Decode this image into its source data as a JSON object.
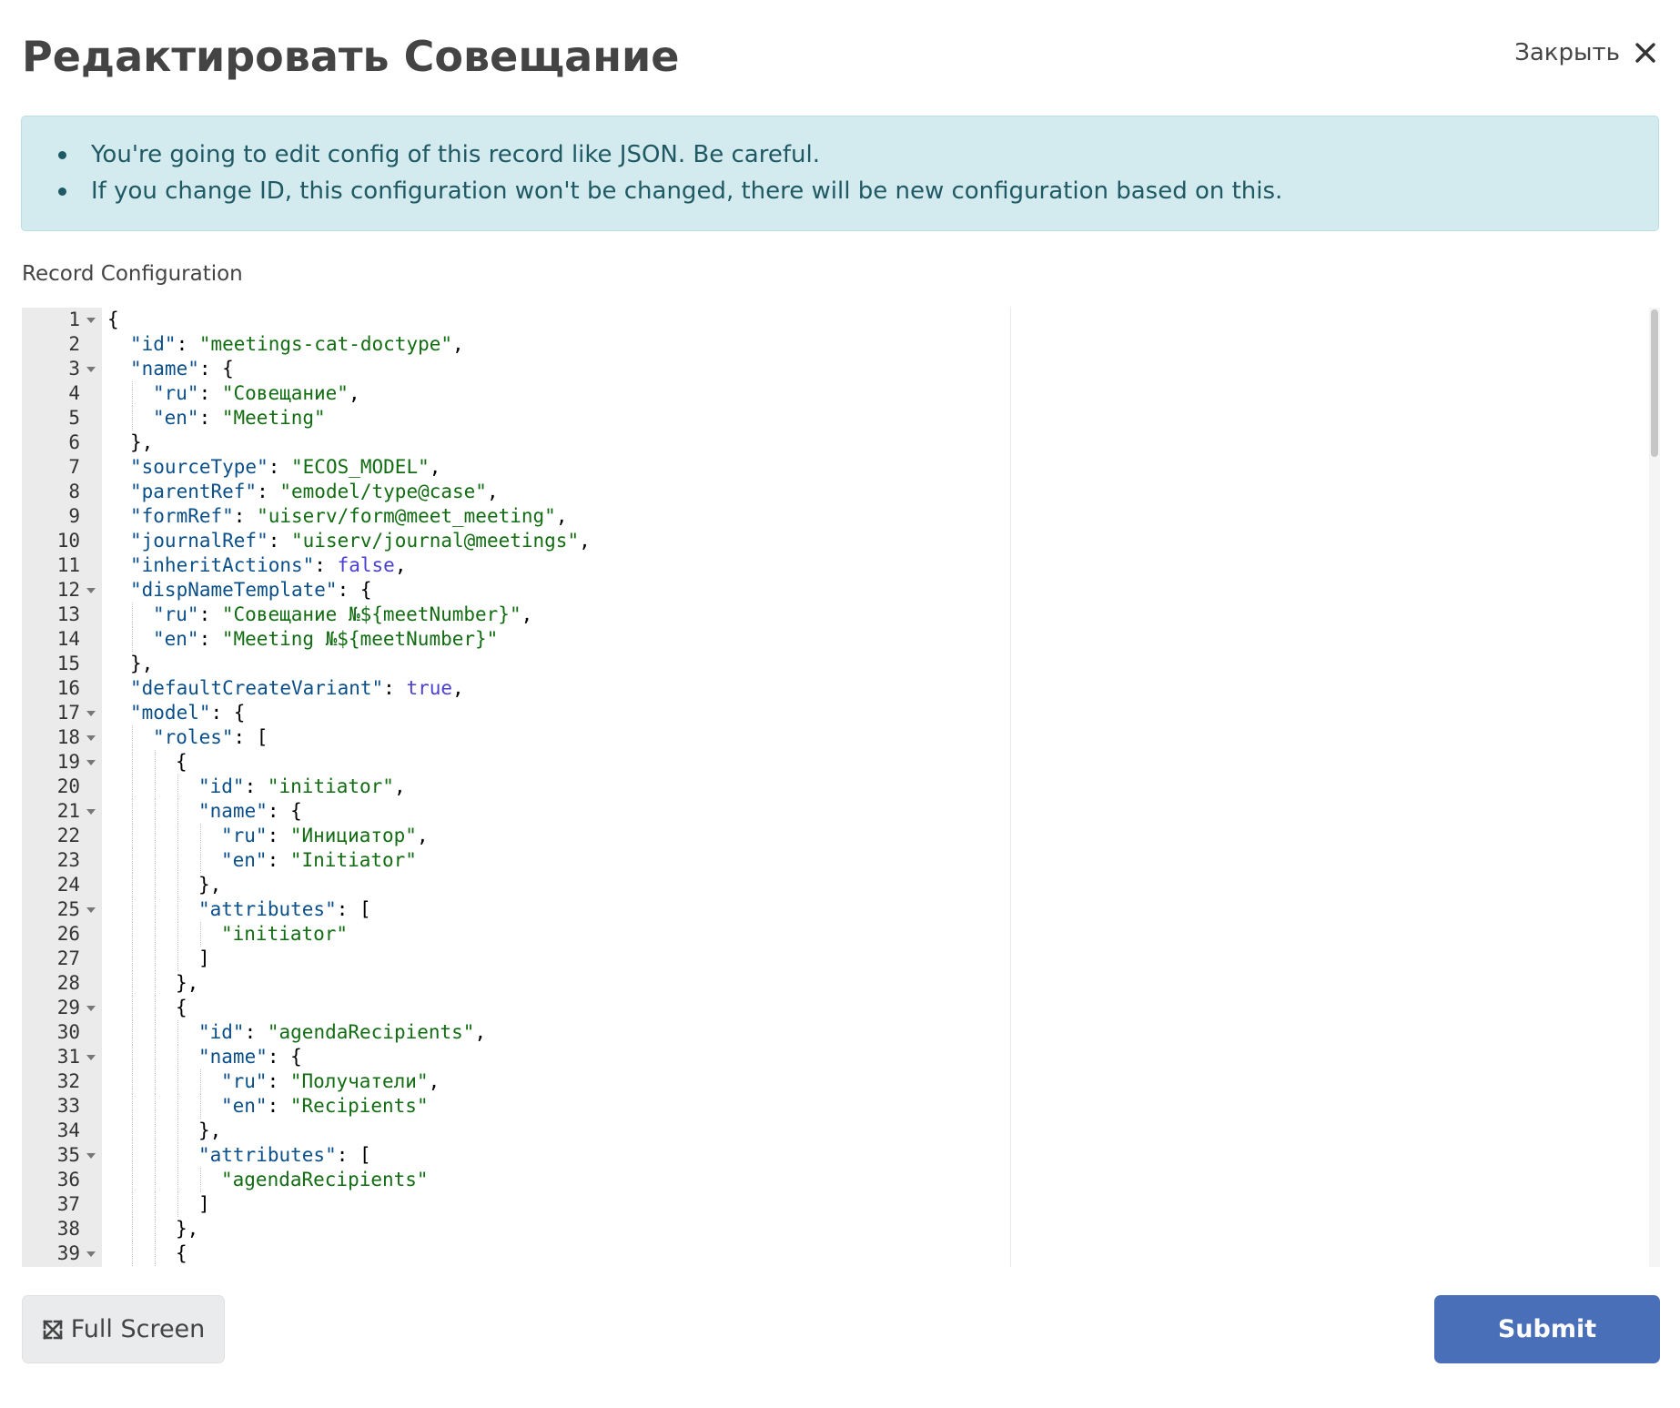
{
  "header": {
    "title": "Редактировать Совещание",
    "close_label": "Закрыть"
  },
  "alert": {
    "items": [
      "You're going to edit config of this record like JSON. Be careful.",
      "If you change ID, this configuration won't be changed, there will be new configuration based on this."
    ]
  },
  "editor": {
    "label": "Record Configuration",
    "lines": [
      {
        "n": "1",
        "fold": true,
        "indent": 0,
        "tokens": [
          {
            "t": "p",
            "v": "{"
          }
        ]
      },
      {
        "n": "2",
        "fold": false,
        "indent": 1,
        "tokens": [
          {
            "t": "k",
            "v": "\"id\""
          },
          {
            "t": "p",
            "v": ": "
          },
          {
            "t": "s",
            "v": "\"meetings-cat-doctype\""
          },
          {
            "t": "p",
            "v": ","
          }
        ]
      },
      {
        "n": "3",
        "fold": true,
        "indent": 1,
        "tokens": [
          {
            "t": "k",
            "v": "\"name\""
          },
          {
            "t": "p",
            "v": ": {"
          }
        ]
      },
      {
        "n": "4",
        "fold": false,
        "indent": 2,
        "tokens": [
          {
            "t": "k",
            "v": "\"ru\""
          },
          {
            "t": "p",
            "v": ": "
          },
          {
            "t": "s",
            "v": "\"Совещание\""
          },
          {
            "t": "p",
            "v": ","
          }
        ]
      },
      {
        "n": "5",
        "fold": false,
        "indent": 2,
        "tokens": [
          {
            "t": "k",
            "v": "\"en\""
          },
          {
            "t": "p",
            "v": ": "
          },
          {
            "t": "s",
            "v": "\"Meeting\""
          }
        ]
      },
      {
        "n": "6",
        "fold": false,
        "indent": 1,
        "tokens": [
          {
            "t": "p",
            "v": "},"
          }
        ]
      },
      {
        "n": "7",
        "fold": false,
        "indent": 1,
        "tokens": [
          {
            "t": "k",
            "v": "\"sourceType\""
          },
          {
            "t": "p",
            "v": ": "
          },
          {
            "t": "s",
            "v": "\"ECOS_MODEL\""
          },
          {
            "t": "p",
            "v": ","
          }
        ]
      },
      {
        "n": "8",
        "fold": false,
        "indent": 1,
        "tokens": [
          {
            "t": "k",
            "v": "\"parentRef\""
          },
          {
            "t": "p",
            "v": ": "
          },
          {
            "t": "s",
            "v": "\"emodel/type@case\""
          },
          {
            "t": "p",
            "v": ","
          }
        ]
      },
      {
        "n": "9",
        "fold": false,
        "indent": 1,
        "tokens": [
          {
            "t": "k",
            "v": "\"formRef\""
          },
          {
            "t": "p",
            "v": ": "
          },
          {
            "t": "s",
            "v": "\"uiserv/form@meet_meeting\""
          },
          {
            "t": "p",
            "v": ","
          }
        ]
      },
      {
        "n": "10",
        "fold": false,
        "indent": 1,
        "tokens": [
          {
            "t": "k",
            "v": "\"journalRef\""
          },
          {
            "t": "p",
            "v": ": "
          },
          {
            "t": "s",
            "v": "\"uiserv/journal@meetings\""
          },
          {
            "t": "p",
            "v": ","
          }
        ]
      },
      {
        "n": "11",
        "fold": false,
        "indent": 1,
        "tokens": [
          {
            "t": "k",
            "v": "\"inheritActions\""
          },
          {
            "t": "p",
            "v": ": "
          },
          {
            "t": "b",
            "v": "false"
          },
          {
            "t": "p",
            "v": ","
          }
        ]
      },
      {
        "n": "12",
        "fold": true,
        "indent": 1,
        "tokens": [
          {
            "t": "k",
            "v": "\"dispNameTemplate\""
          },
          {
            "t": "p",
            "v": ": {"
          }
        ]
      },
      {
        "n": "13",
        "fold": false,
        "indent": 2,
        "tokens": [
          {
            "t": "k",
            "v": "\"ru\""
          },
          {
            "t": "p",
            "v": ": "
          },
          {
            "t": "s",
            "v": "\"Совещание №${meetNumber}\""
          },
          {
            "t": "p",
            "v": ","
          }
        ]
      },
      {
        "n": "14",
        "fold": false,
        "indent": 2,
        "tokens": [
          {
            "t": "k",
            "v": "\"en\""
          },
          {
            "t": "p",
            "v": ": "
          },
          {
            "t": "s",
            "v": "\"Meeting №${meetNumber}\""
          }
        ]
      },
      {
        "n": "15",
        "fold": false,
        "indent": 1,
        "tokens": [
          {
            "t": "p",
            "v": "},"
          }
        ]
      },
      {
        "n": "16",
        "fold": false,
        "indent": 1,
        "tokens": [
          {
            "t": "k",
            "v": "\"defaultCreateVariant\""
          },
          {
            "t": "p",
            "v": ": "
          },
          {
            "t": "b",
            "v": "true"
          },
          {
            "t": "p",
            "v": ","
          }
        ]
      },
      {
        "n": "17",
        "fold": true,
        "indent": 1,
        "tokens": [
          {
            "t": "k",
            "v": "\"model\""
          },
          {
            "t": "p",
            "v": ": {"
          }
        ]
      },
      {
        "n": "18",
        "fold": true,
        "indent": 2,
        "tokens": [
          {
            "t": "k",
            "v": "\"roles\""
          },
          {
            "t": "p",
            "v": ": ["
          }
        ]
      },
      {
        "n": "19",
        "fold": true,
        "indent": 3,
        "tokens": [
          {
            "t": "p",
            "v": "{"
          }
        ]
      },
      {
        "n": "20",
        "fold": false,
        "indent": 4,
        "tokens": [
          {
            "t": "k",
            "v": "\"id\""
          },
          {
            "t": "p",
            "v": ": "
          },
          {
            "t": "s",
            "v": "\"initiator\""
          },
          {
            "t": "p",
            "v": ","
          }
        ]
      },
      {
        "n": "21",
        "fold": true,
        "indent": 4,
        "tokens": [
          {
            "t": "k",
            "v": "\"name\""
          },
          {
            "t": "p",
            "v": ": {"
          }
        ]
      },
      {
        "n": "22",
        "fold": false,
        "indent": 5,
        "tokens": [
          {
            "t": "k",
            "v": "\"ru\""
          },
          {
            "t": "p",
            "v": ": "
          },
          {
            "t": "s",
            "v": "\"Инициатор\""
          },
          {
            "t": "p",
            "v": ","
          }
        ]
      },
      {
        "n": "23",
        "fold": false,
        "indent": 5,
        "tokens": [
          {
            "t": "k",
            "v": "\"en\""
          },
          {
            "t": "p",
            "v": ": "
          },
          {
            "t": "s",
            "v": "\"Initiator\""
          }
        ]
      },
      {
        "n": "24",
        "fold": false,
        "indent": 4,
        "tokens": [
          {
            "t": "p",
            "v": "},"
          }
        ]
      },
      {
        "n": "25",
        "fold": true,
        "indent": 4,
        "tokens": [
          {
            "t": "k",
            "v": "\"attributes\""
          },
          {
            "t": "p",
            "v": ": ["
          }
        ]
      },
      {
        "n": "26",
        "fold": false,
        "indent": 5,
        "tokens": [
          {
            "t": "s",
            "v": "\"initiator\""
          }
        ]
      },
      {
        "n": "27",
        "fold": false,
        "indent": 4,
        "tokens": [
          {
            "t": "p",
            "v": "]"
          }
        ]
      },
      {
        "n": "28",
        "fold": false,
        "indent": 3,
        "tokens": [
          {
            "t": "p",
            "v": "},"
          }
        ]
      },
      {
        "n": "29",
        "fold": true,
        "indent": 3,
        "tokens": [
          {
            "t": "p",
            "v": "{"
          }
        ]
      },
      {
        "n": "30",
        "fold": false,
        "indent": 4,
        "tokens": [
          {
            "t": "k",
            "v": "\"id\""
          },
          {
            "t": "p",
            "v": ": "
          },
          {
            "t": "s",
            "v": "\"agendaRecipients\""
          },
          {
            "t": "p",
            "v": ","
          }
        ]
      },
      {
        "n": "31",
        "fold": true,
        "indent": 4,
        "tokens": [
          {
            "t": "k",
            "v": "\"name\""
          },
          {
            "t": "p",
            "v": ": {"
          }
        ]
      },
      {
        "n": "32",
        "fold": false,
        "indent": 5,
        "tokens": [
          {
            "t": "k",
            "v": "\"ru\""
          },
          {
            "t": "p",
            "v": ": "
          },
          {
            "t": "s",
            "v": "\"Получатели\""
          },
          {
            "t": "p",
            "v": ","
          }
        ]
      },
      {
        "n": "33",
        "fold": false,
        "indent": 5,
        "tokens": [
          {
            "t": "k",
            "v": "\"en\""
          },
          {
            "t": "p",
            "v": ": "
          },
          {
            "t": "s",
            "v": "\"Recipients\""
          }
        ]
      },
      {
        "n": "34",
        "fold": false,
        "indent": 4,
        "tokens": [
          {
            "t": "p",
            "v": "},"
          }
        ]
      },
      {
        "n": "35",
        "fold": true,
        "indent": 4,
        "tokens": [
          {
            "t": "k",
            "v": "\"attributes\""
          },
          {
            "t": "p",
            "v": ": ["
          }
        ]
      },
      {
        "n": "36",
        "fold": false,
        "indent": 5,
        "tokens": [
          {
            "t": "s",
            "v": "\"agendaRecipients\""
          }
        ]
      },
      {
        "n": "37",
        "fold": false,
        "indent": 4,
        "tokens": [
          {
            "t": "p",
            "v": "]"
          }
        ]
      },
      {
        "n": "38",
        "fold": false,
        "indent": 3,
        "tokens": [
          {
            "t": "p",
            "v": "},"
          }
        ]
      },
      {
        "n": "39",
        "fold": true,
        "indent": 3,
        "tokens": [
          {
            "t": "p",
            "v": "{"
          }
        ]
      }
    ]
  },
  "footer": {
    "fullscreen_label": "Full Screen",
    "submit_label": "Submit"
  },
  "colors": {
    "alert_bg": "#d3ebee",
    "alert_text": "#1f5964",
    "submit_bg": "#4a6fb9",
    "json_key": "#0a4f8a",
    "json_string": "#126c12",
    "json_boolean": "#4a3fd0"
  },
  "icons": {
    "close": "close-icon",
    "fullscreen": "expand-icon"
  }
}
